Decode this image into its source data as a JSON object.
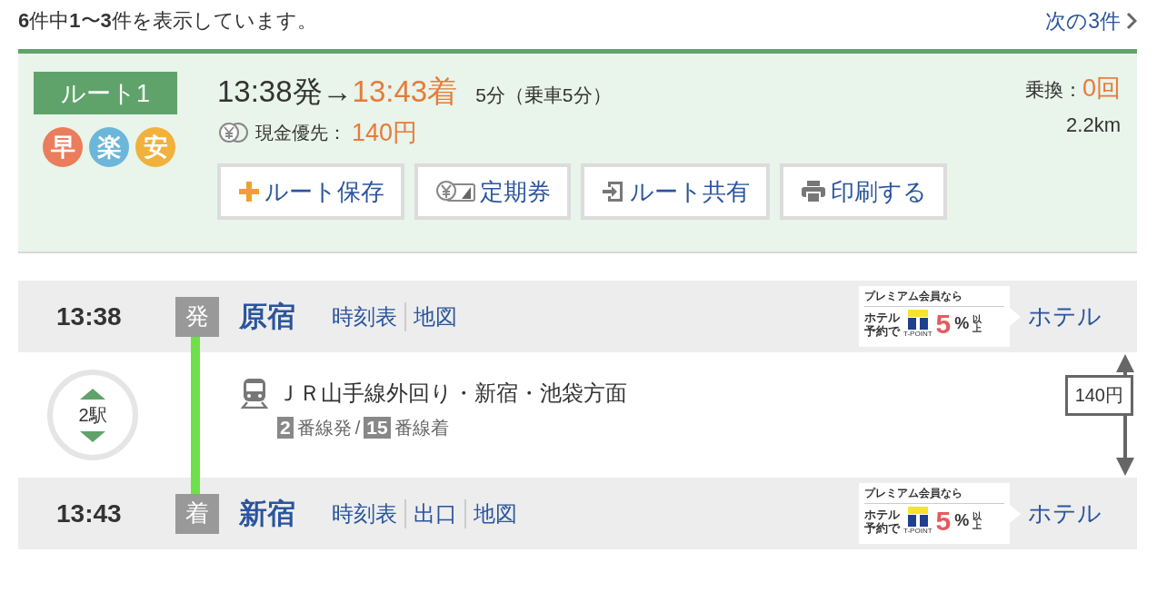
{
  "header": {
    "summary": "**6**件中**1**〜**3**件を表示しています。",
    "next": "次の3件"
  },
  "route": {
    "badge": "ルート1",
    "tags": [
      {
        "label": "早",
        "color": "#ea7d5b"
      },
      {
        "label": "楽",
        "color": "#6cb6da"
      },
      {
        "label": "安",
        "color": "#f0b23d"
      }
    ],
    "departure": "13:38発",
    "arrow": "→",
    "arrival": "13:43着",
    "duration": "5分（乗車5分）",
    "fare_label": "現金優先：",
    "fare": "140円",
    "transfers_label": "乗換：",
    "transfers": "0回",
    "distance": "2.2km",
    "actions": [
      {
        "kind": "save",
        "label": "ルート保存"
      },
      {
        "kind": "pass",
        "label": "定期券"
      },
      {
        "kind": "share",
        "label": "ルート共有"
      },
      {
        "kind": "print",
        "label": "印刷する"
      }
    ]
  },
  "stops": [
    {
      "time": "13:38",
      "mark": "発",
      "name": "原宿",
      "links": [
        "時刻表",
        "地図"
      ],
      "banner": {
        "headline": "プレミアム会員なら",
        "line_1": "ホテル",
        "line_2": "予約で",
        "brand": "T-POINT",
        "rate": "5",
        "percent": "%",
        "suffix_1": "以",
        "suffix_2": "上"
      },
      "hotel": "ホテル"
    },
    {
      "time": "13:43",
      "mark": "着",
      "name": "新宿",
      "links": [
        "時刻表",
        "出口",
        "地図"
      ],
      "banner": {
        "headline": "プレミアム会員なら",
        "line_1": "ホテル",
        "line_2": "予約で",
        "brand": "T-POINT",
        "rate": "5",
        "percent": "%",
        "suffix_1": "以",
        "suffix_2": "上"
      },
      "hotel": "ホテル"
    }
  ],
  "segment": {
    "stations": "2駅",
    "line": "ＪＲ山手線外回り・新宿・池袋方面",
    "from_track": "2",
    "from_label": "番線発",
    "separator": "/",
    "to_track": "15",
    "to_label": "番線着",
    "fare": "140円"
  }
}
